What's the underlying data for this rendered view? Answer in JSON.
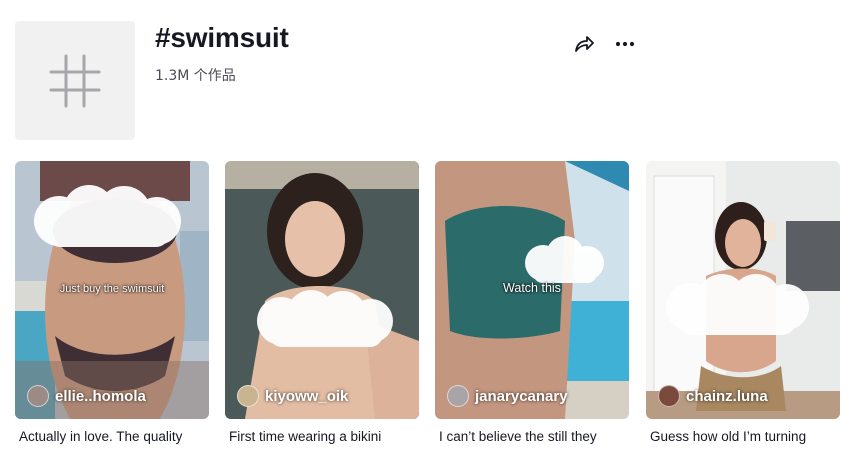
{
  "tag": {
    "title": "#swimsuit",
    "count": "1.3M 个作品",
    "icon": "hashtag-icon"
  },
  "actions": {
    "share_icon": "share-arrow-icon",
    "more_icon": "more-dots-icon"
  },
  "videos": [
    {
      "overlay_text": "Just buy the swimsuit",
      "author": "ellie..homola",
      "caption": "Actually in love. The quality"
    },
    {
      "overlay_text": "",
      "author": "kiyoww_oik",
      "caption": "First time wearing a bikini"
    },
    {
      "overlay_text": "Watch this",
      "author": "janarycanary",
      "caption": "I can’t believe the still they"
    },
    {
      "overlay_text": "",
      "author": "chainz.luna",
      "caption": "Guess how old I’m turning"
    }
  ]
}
